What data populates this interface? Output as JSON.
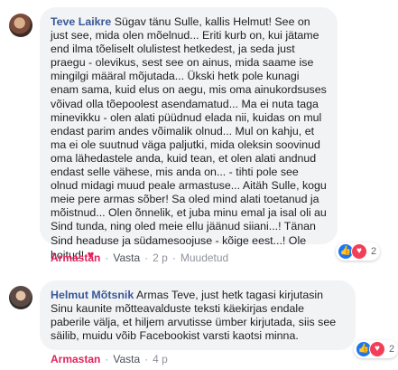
{
  "comments": [
    {
      "author": "Teve Laikre",
      "text": "Sügav tänu Sulle, kallis Helmut! See on just see, mida olen mõelnud... Eriti kurb on, kui jätame end ilma tõeliselt olulistest hetkedest, ja seda just praegu - olevikus, sest see on ainus, mida saame ise mingilgi määral mõjutada... Ükski hetk pole kunagi enam sama, kuid elus on aegu, mis oma ainukordsuses võivad olla tõepoolest asendamatud... Ma ei nuta taga minevikku - olen alati püüdnud elada nii, kuidas on mul endast parim andes võimalik olnud... Mul on kahju, et ma ei ole suutnud väga paljutki, mida oleksin soovinud oma lähedastele anda, kuid tean, et olen alati andnud endast selle vähese, mis anda on... - tihti pole see olnud midagi muud peale armastuse... Aitäh Sulle, kogu meie pere armas sõber! Sa oled mind alati toetanud ja mõistnud... Olen õnnelik, et juba minu emal ja isal oli au Sind tunda, ning oled meie ellu jäänud siiani...! Tänan Sind headuse ja südamesoojuse - kõige eest...! Ole hoitud!",
      "emoji": "♥",
      "reaction_count": "2",
      "action_like": "Armastan",
      "action_reply": "Vasta",
      "time": "2 p",
      "edited": "Muudetud"
    },
    {
      "author": "Helmut Mõtsnik",
      "text": "Armas Teve, just hetk tagasi kirjutasin Sinu kaunite mõtteavalduste teksti käekirjas endale paberile välja, et hiljem arvutisse ümber kirjutada, siis see säilib, muidu võib Facebookist varsti kaotsi minna.",
      "reaction_count": "2",
      "action_like": "Armastan",
      "action_reply": "Vasta",
      "time": "4 p"
    }
  ],
  "reaction_icons": [
    "like-icon",
    "love-icon"
  ],
  "colors": {
    "author": "#385898",
    "liked": "#e0245e",
    "bubble": "#f2f3f5",
    "meta": "#90949c"
  }
}
